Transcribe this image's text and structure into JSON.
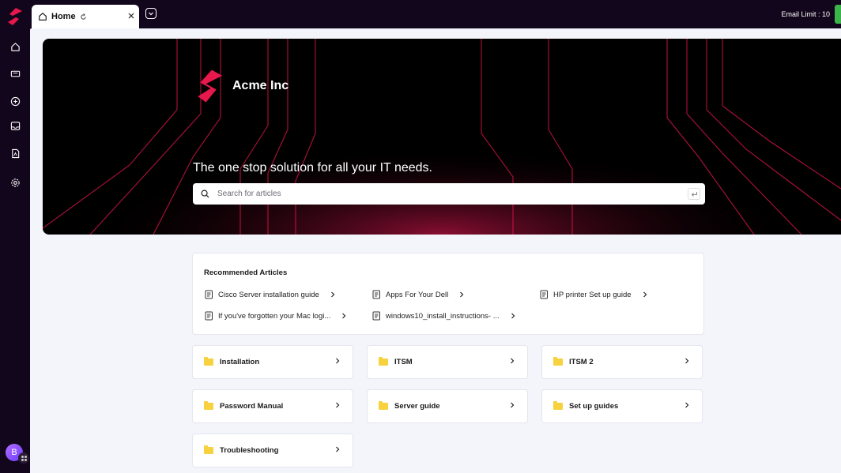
{
  "topbar": {
    "tab_label": "Home",
    "email_limit": "Email Limit : 10"
  },
  "rail": {
    "items": [
      "home-icon",
      "ticket-icon",
      "add-icon",
      "inbox-icon",
      "document-icon",
      "gear-icon"
    ],
    "avatar_initial": "B"
  },
  "hero": {
    "brand_name": "Acme Inc",
    "tagline": "The one stop solution for all your IT needs.",
    "search_placeholder": "Search for articles"
  },
  "recommended": {
    "title": "Recommended Articles",
    "items": [
      {
        "label": "Cisco Server installation guide"
      },
      {
        "label": "Apps For Your Dell"
      },
      {
        "label": "HP printer Set up guide"
      },
      {
        "label": "If you've forgotten your Mac logi..."
      },
      {
        "label": "windows10_install_instructions- ..."
      }
    ]
  },
  "categories": [
    {
      "label": "Installation"
    },
    {
      "label": "ITSM"
    },
    {
      "label": "ITSM 2"
    },
    {
      "label": "Password Manual"
    },
    {
      "label": "Server guide"
    },
    {
      "label": "Set up guides"
    },
    {
      "label": "Troubleshooting"
    }
  ],
  "colors": {
    "accent": "#e8174c",
    "rail_bg": "#12061c",
    "email_limit_bar": "#3bb54a",
    "folder": "#f7d23e"
  }
}
